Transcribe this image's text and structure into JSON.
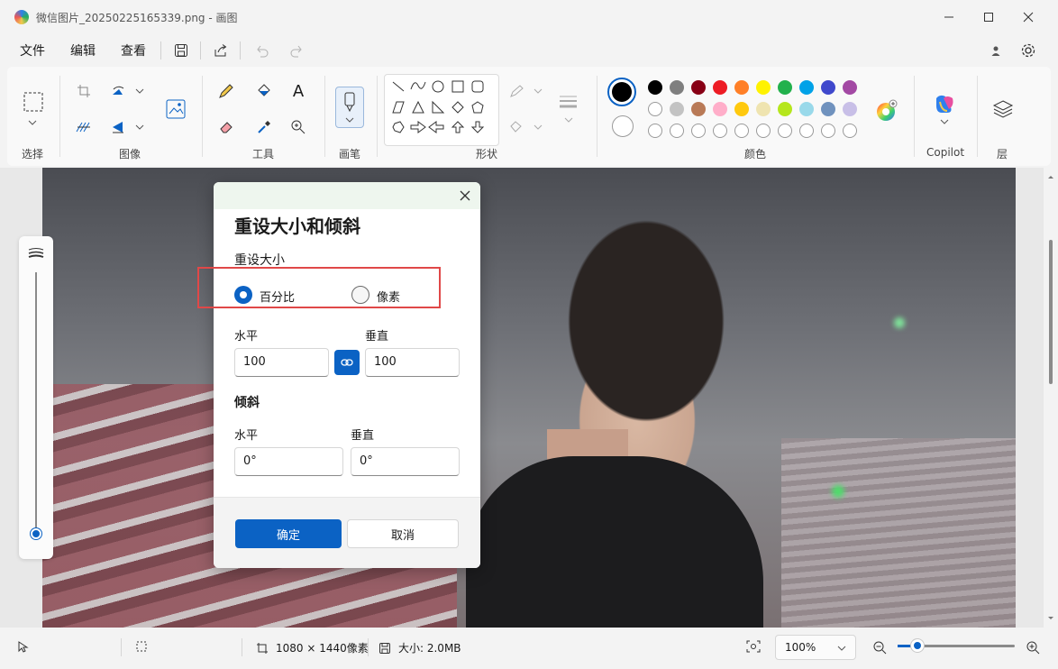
{
  "window": {
    "title": "微信图片_20250225165339.png - 画图"
  },
  "menu": {
    "file": "文件",
    "edit": "编辑",
    "view": "查看"
  },
  "ribbon": {
    "groups": {
      "select": "选择",
      "image": "图像",
      "tools": "工具",
      "brushes": "画笔",
      "shapes": "形状",
      "colors": "颜色",
      "copilot": "Copilot",
      "layers": "层"
    },
    "text_tool_glyph": "A",
    "colors_row1": [
      "#000000",
      "#7f7f7f",
      "#880015",
      "#ed1c24",
      "#ff7f27",
      "#fff200",
      "#22b14c",
      "#00a2e8",
      "#3f48cc",
      "#a349a4"
    ],
    "colors_row2": [
      "#ffffff",
      "#c3c3c3",
      "#b97a57",
      "#ffaec9",
      "#ffc90e",
      "#efe4b0",
      "#b5e61d",
      "#99d9ea",
      "#7092be",
      "#c8bfe7"
    ],
    "primary_color": "#000000",
    "secondary_color": "#ffffff"
  },
  "dialog": {
    "title": "重设大小和倾斜",
    "resize_section": "重设大小",
    "option_percent": "百分比",
    "option_pixels": "像素",
    "selected_option": "百分比",
    "resize": {
      "horizontal_label": "水平",
      "vertical_label": "垂直",
      "horizontal_value": "100",
      "vertical_value": "100"
    },
    "skew_section": "倾斜",
    "skew": {
      "horizontal_label": "水平",
      "vertical_label": "垂直",
      "horizontal_value": "0°",
      "vertical_value": "0°"
    },
    "ok": "确定",
    "cancel": "取消"
  },
  "status": {
    "image_size": "1080 × 1440像素",
    "file_size": "大小: 2.0MB",
    "zoom": "100%"
  }
}
